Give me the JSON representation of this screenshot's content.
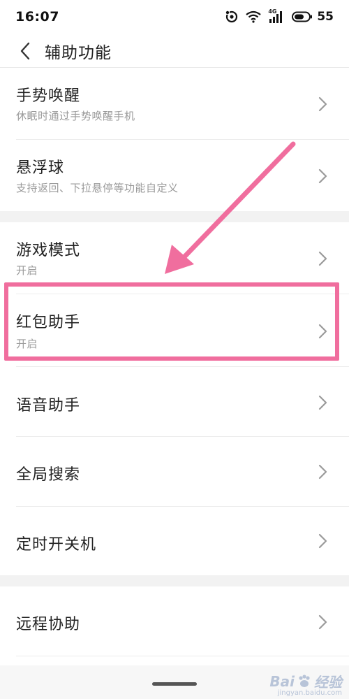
{
  "status_bar": {
    "time": "16:07",
    "network": "4G",
    "battery": "55",
    "icons": [
      "headset-icon",
      "wifi-icon",
      "signal-icon",
      "battery-icon"
    ]
  },
  "header": {
    "back_icon": "chevron-left-icon",
    "title": "辅助功能"
  },
  "group1": [
    {
      "title": "手势唤醒",
      "subtitle": "休眠时通过手势唤醒手机"
    },
    {
      "title": "悬浮球",
      "subtitle": "支持返回、下拉悬停等功能自定义"
    }
  ],
  "group2": [
    {
      "title": "游戏模式",
      "subtitle": "开启"
    },
    {
      "title": "红包助手",
      "subtitle": "开启"
    },
    {
      "title": "语音助手"
    },
    {
      "title": "全局搜索"
    },
    {
      "title": "定时开关机"
    }
  ],
  "group3": [
    {
      "title": "远程协助"
    }
  ],
  "annotation": {
    "highlight_color": "#f06e9e",
    "arrow_color": "#f06e9e"
  },
  "watermark": {
    "text_left": "Bai",
    "text_right": "经验",
    "sub": "jingyan.baidu.com"
  }
}
